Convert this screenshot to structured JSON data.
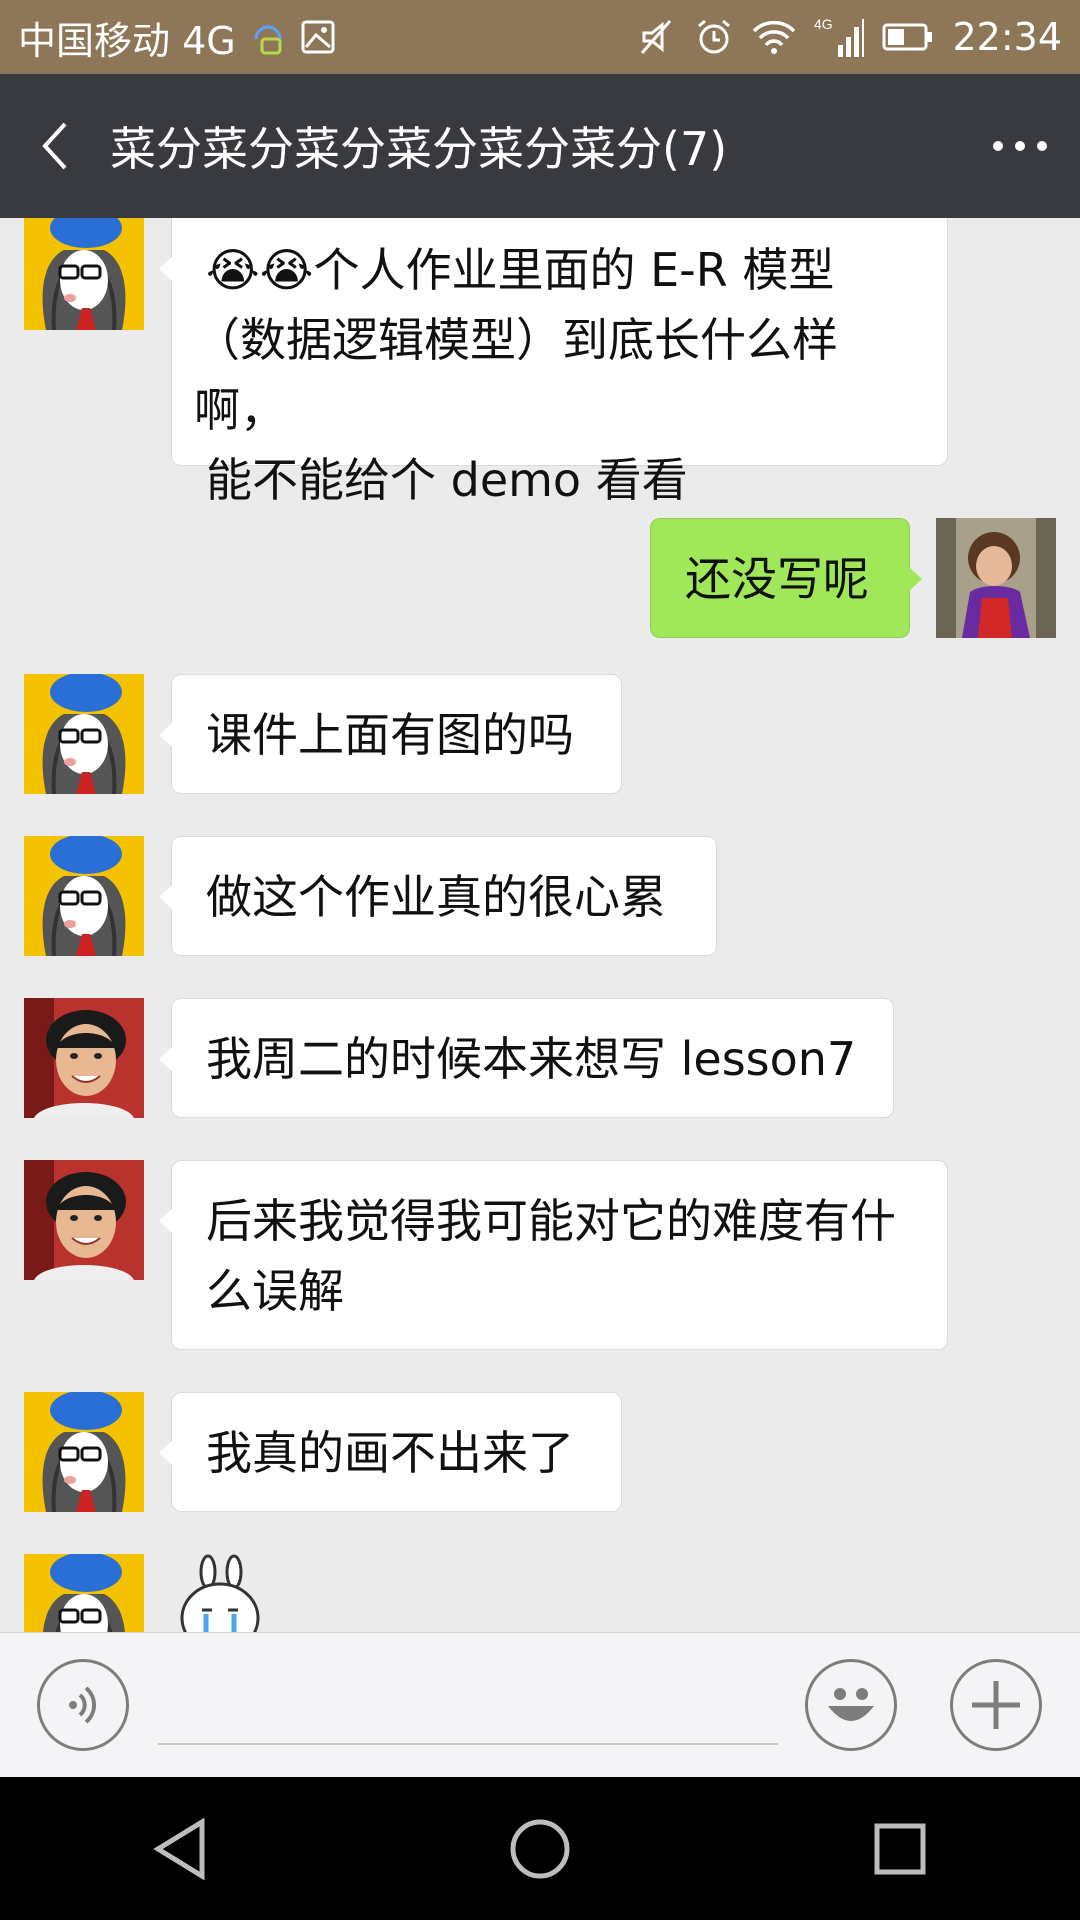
{
  "status_bar": {
    "carrier": "中国移动 4G",
    "time": "22:34",
    "icons": [
      "sim-hd-icon",
      "gallery-icon",
      "mute-icon",
      "alarm-icon",
      "wifi-icon",
      "signal-icon",
      "battery-icon"
    ]
  },
  "header": {
    "title": "菜分菜分菜分菜分菜分菜分(7)",
    "back_icon": "back-arrow-icon",
    "more_icon": "more-dots-icon"
  },
  "messages": [
    {
      "side": "in",
      "avatar": "girl-cartoon-avatar",
      "lines": [
        "😭😭个人作业里面的 E-R 模型",
        "（数据逻辑模型）到底长什么样啊，",
        "能不能给个 demo 看看"
      ]
    },
    {
      "side": "out",
      "avatar": "child-photo-avatar",
      "lines": [
        "还没写呢"
      ]
    },
    {
      "side": "in",
      "avatar": "girl-cartoon-avatar",
      "lines": [
        "课件上面有图的吗"
      ]
    },
    {
      "side": "in",
      "avatar": "girl-cartoon-avatar",
      "lines": [
        "做这个作业真的很心累"
      ]
    },
    {
      "side": "in",
      "avatar": "man-photo-avatar",
      "lines": [
        "我周二的时候本来想写 lesson7"
      ]
    },
    {
      "side": "in",
      "avatar": "man-photo-avatar",
      "lines": [
        "后来我觉得我可能对它的难度有什",
        "么误解"
      ]
    },
    {
      "side": "in",
      "avatar": "girl-cartoon-avatar",
      "lines": [
        "我真的画不出来了"
      ]
    },
    {
      "side": "in",
      "avatar": "girl-cartoon-avatar",
      "sticker": "crying-rabbit-sticker"
    }
  ],
  "input_bar": {
    "voice_icon": "voice-icon",
    "emoji_icon": "emoji-icon",
    "plus_icon": "plus-icon",
    "text_value": ""
  },
  "nav_bar": {
    "icons": [
      "back-triangle-icon",
      "home-circle-icon",
      "recents-square-icon"
    ]
  },
  "colors": {
    "status_bar": "#8d7758",
    "title_bar": "#393a3f",
    "background": "#ebebeb",
    "bubble_out": "#a0e759",
    "bubble_in": "#ffffff"
  }
}
